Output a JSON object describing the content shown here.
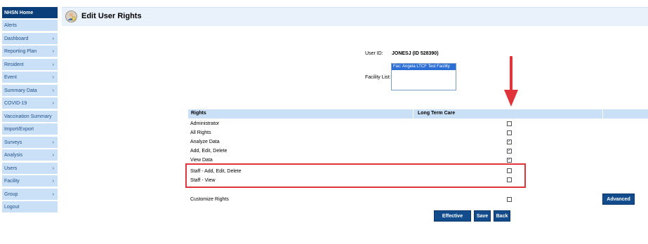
{
  "sidebar": {
    "items": [
      {
        "label": "NHSN Home",
        "arrow": false
      },
      {
        "label": "Alerts",
        "arrow": false
      },
      {
        "label": "Dashboard",
        "arrow": true
      },
      {
        "label": "Reporting Plan",
        "arrow": true
      },
      {
        "label": "Resident",
        "arrow": true
      },
      {
        "label": "Event",
        "arrow": true
      },
      {
        "label": "Summary Data",
        "arrow": true
      },
      {
        "label": "COVID-19",
        "arrow": true
      },
      {
        "label": "Vaccination Summary",
        "arrow": false
      },
      {
        "label": "Import/Export",
        "arrow": false
      },
      {
        "label": "Surveys",
        "arrow": true
      },
      {
        "label": "Analysis",
        "arrow": true
      },
      {
        "label": "Users",
        "arrow": true
      },
      {
        "label": "Facility",
        "arrow": true
      },
      {
        "label": "Group",
        "arrow": true
      },
      {
        "label": "Logout",
        "arrow": false
      }
    ],
    "arrow_glyph": "›"
  },
  "header": {
    "title": "Edit User Rights"
  },
  "form": {
    "user_id_label": "User ID:",
    "user_id_value": "JONESJ (ID 528390)",
    "facility_list_label": "Facility List:",
    "facility_option": "Fac: Angela LTCF Test Facility"
  },
  "rights_table": {
    "col_rights": "Rights",
    "col_ltc": "Long Term Care",
    "rows": [
      {
        "label": "Administrator",
        "checked": false
      },
      {
        "label": "All Rights",
        "checked": false
      },
      {
        "label": "Analyze Data",
        "checked": true
      },
      {
        "label": "Add, Edit, Delete",
        "checked": true
      },
      {
        "label": "View Data",
        "checked": true
      },
      {
        "label": "Staff - Add, Edit, Delete",
        "checked": false
      },
      {
        "label": "Staff - View",
        "checked": false
      }
    ],
    "customize_label": "Customize Rights",
    "customize_checked": false
  },
  "buttons": {
    "advanced": "Advanced",
    "effective_rights": "Effective Rights",
    "save": "Save",
    "back": "Back"
  },
  "colors": {
    "highlight": "#e0343a",
    "button": "#134c8c",
    "nav": "#c9e0f6"
  }
}
